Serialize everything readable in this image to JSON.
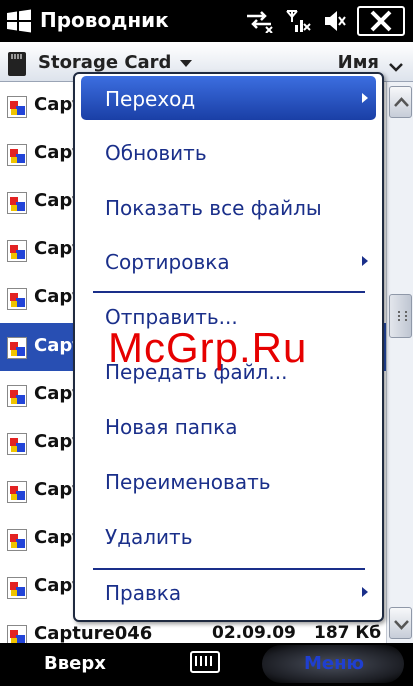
{
  "titlebar": {
    "title": "Проводник",
    "icons": [
      "connectivity-icon",
      "signal-icon",
      "volume-icon",
      "close-icon"
    ]
  },
  "pathbar": {
    "location": "Storage Card",
    "sort_by": "Имя"
  },
  "files": [
    {
      "name": "Captu",
      "date": "",
      "size": ""
    },
    {
      "name": "Captu",
      "date": "",
      "size": ""
    },
    {
      "name": "Captu",
      "date": "",
      "size": ""
    },
    {
      "name": "Captu",
      "date": "",
      "size": ""
    },
    {
      "name": "Captu",
      "date": "",
      "size": ""
    },
    {
      "name": "Captu",
      "date": "",
      "size": "",
      "selected": true
    },
    {
      "name": "Captu",
      "date": "",
      "size": ""
    },
    {
      "name": "Captu",
      "date": "",
      "size": ""
    },
    {
      "name": "Captu",
      "date": "",
      "size": ""
    },
    {
      "name": "Captu",
      "date": "",
      "size": ""
    },
    {
      "name": "Captu",
      "date": "",
      "size": ""
    },
    {
      "name": "Capture046",
      "date": "02.09.09",
      "size": "187 Кб"
    }
  ],
  "menu": {
    "items": [
      {
        "label": "Переход",
        "submenu": true,
        "highlight": true
      },
      {
        "label": "Обновить"
      },
      {
        "label": "Показать все файлы"
      },
      {
        "label": "Сортировка",
        "submenu": true
      },
      {
        "label": "Отправить..."
      },
      {
        "label": "Передать файл..."
      },
      {
        "label": "Новая папка"
      },
      {
        "label": "Переименовать"
      },
      {
        "label": "Удалить"
      },
      {
        "label": "Правка",
        "submenu": true
      }
    ]
  },
  "watermark": "McGrp.Ru",
  "softkeys": {
    "left": "Вверх",
    "right": "Меню"
  },
  "colors": {
    "menu_text": "#1a2f8a",
    "highlight": "#284fb3",
    "watermark": "#e60000"
  }
}
